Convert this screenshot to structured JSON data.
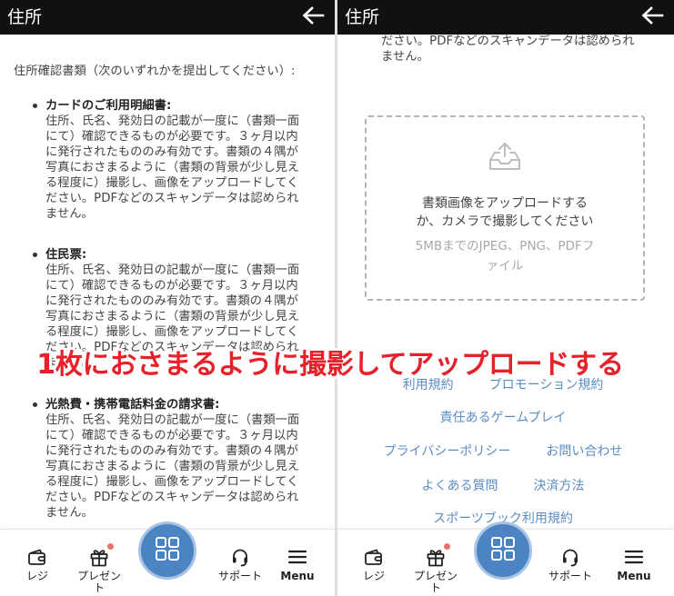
{
  "header": {
    "title": "住所",
    "back_icon": "arrow-left-icon"
  },
  "left_panel": {
    "intro": "住所確認書類（次のいずれかを提出してください）:",
    "documents": [
      {
        "title": "カードのご利用明細書:",
        "lines": [
          "住所、氏名、発効日の記載が一度に（書類一面",
          "にて）確認できるものが必要です。３ヶ月以内",
          "に発行されたもののみ有効です。書類の４隅が",
          "写真におさまるように（書類の背景が少し見え",
          "る程度に）撮影し、画像をアップロードしてく",
          "ださい。PDFなどのスキャンデータは認められ",
          "ません。"
        ]
      },
      {
        "title": "住民票:",
        "lines": [
          "住所、氏名、発効日の記載が一度に（書類一面",
          "にて）確認できるものが必要です。３ヶ月以内",
          "に発行されたもののみ有効です。書類の４隅が",
          "写真におさまるように（書類の背景が少し見え",
          "る程度に）撮影し、画像をアップロードしてく",
          "ださい。PDFなどのスキャンデータは認められ",
          "ません。"
        ]
      },
      {
        "title": "光熱費・携帯電話料金の請求書:",
        "lines": [
          "住所、氏名、発効日の記載が一度に（書類一面",
          "にて）確認できるものが必要です。３ヶ月以内",
          "に発行されたもののみ有効です。書類の４隅が",
          "写真におさまるように（書類の背景が少し見え",
          "る程度に）撮影し、画像をアップロードしてく",
          "ださい。PDFなどのスキャンデータは認められ",
          "ません。"
        ]
      }
    ]
  },
  "right_panel": {
    "continued_lines": [
      "ださい。PDFなどのスキャンデータは認められ",
      "ません。"
    ],
    "upload": {
      "icon": "upload-tray-icon",
      "prompt_lines": [
        "書類画像をアップロードする",
        "か、カメラで撮影してください"
      ],
      "hint_lines": [
        "5MBまでのJPEG、PNG、PDFフ",
        "ァイル"
      ]
    },
    "footer_links": [
      [
        "利用規約",
        "プロモーション規約"
      ],
      [
        "責任あるゲームプレイ"
      ],
      [
        "プライバシーポリシー",
        "お問い合わせ"
      ],
      [
        "よくある質問",
        "決済方法"
      ],
      [
        "スポーツブック利用規約"
      ]
    ]
  },
  "bottom_nav": {
    "items": [
      {
        "label": "レジ",
        "icon": "wallet-icon"
      },
      {
        "label": "プレゼント",
        "icon": "gift-icon",
        "has_badge": true
      },
      {
        "icon": "grid-icon"
      },
      {
        "label": "サポート",
        "icon": "headset-icon"
      },
      {
        "label": "Menu",
        "icon": "hamburger-icon"
      }
    ]
  },
  "overlay_caption": "1枚におさまるように撮影してアップロードする",
  "colors": {
    "header_bg": "#111111",
    "link": "#5b8dc5",
    "fab": "#4b83c3",
    "fab_ring": "#a7c4e5",
    "badge": "#e9735f",
    "caption": "#e62129"
  }
}
